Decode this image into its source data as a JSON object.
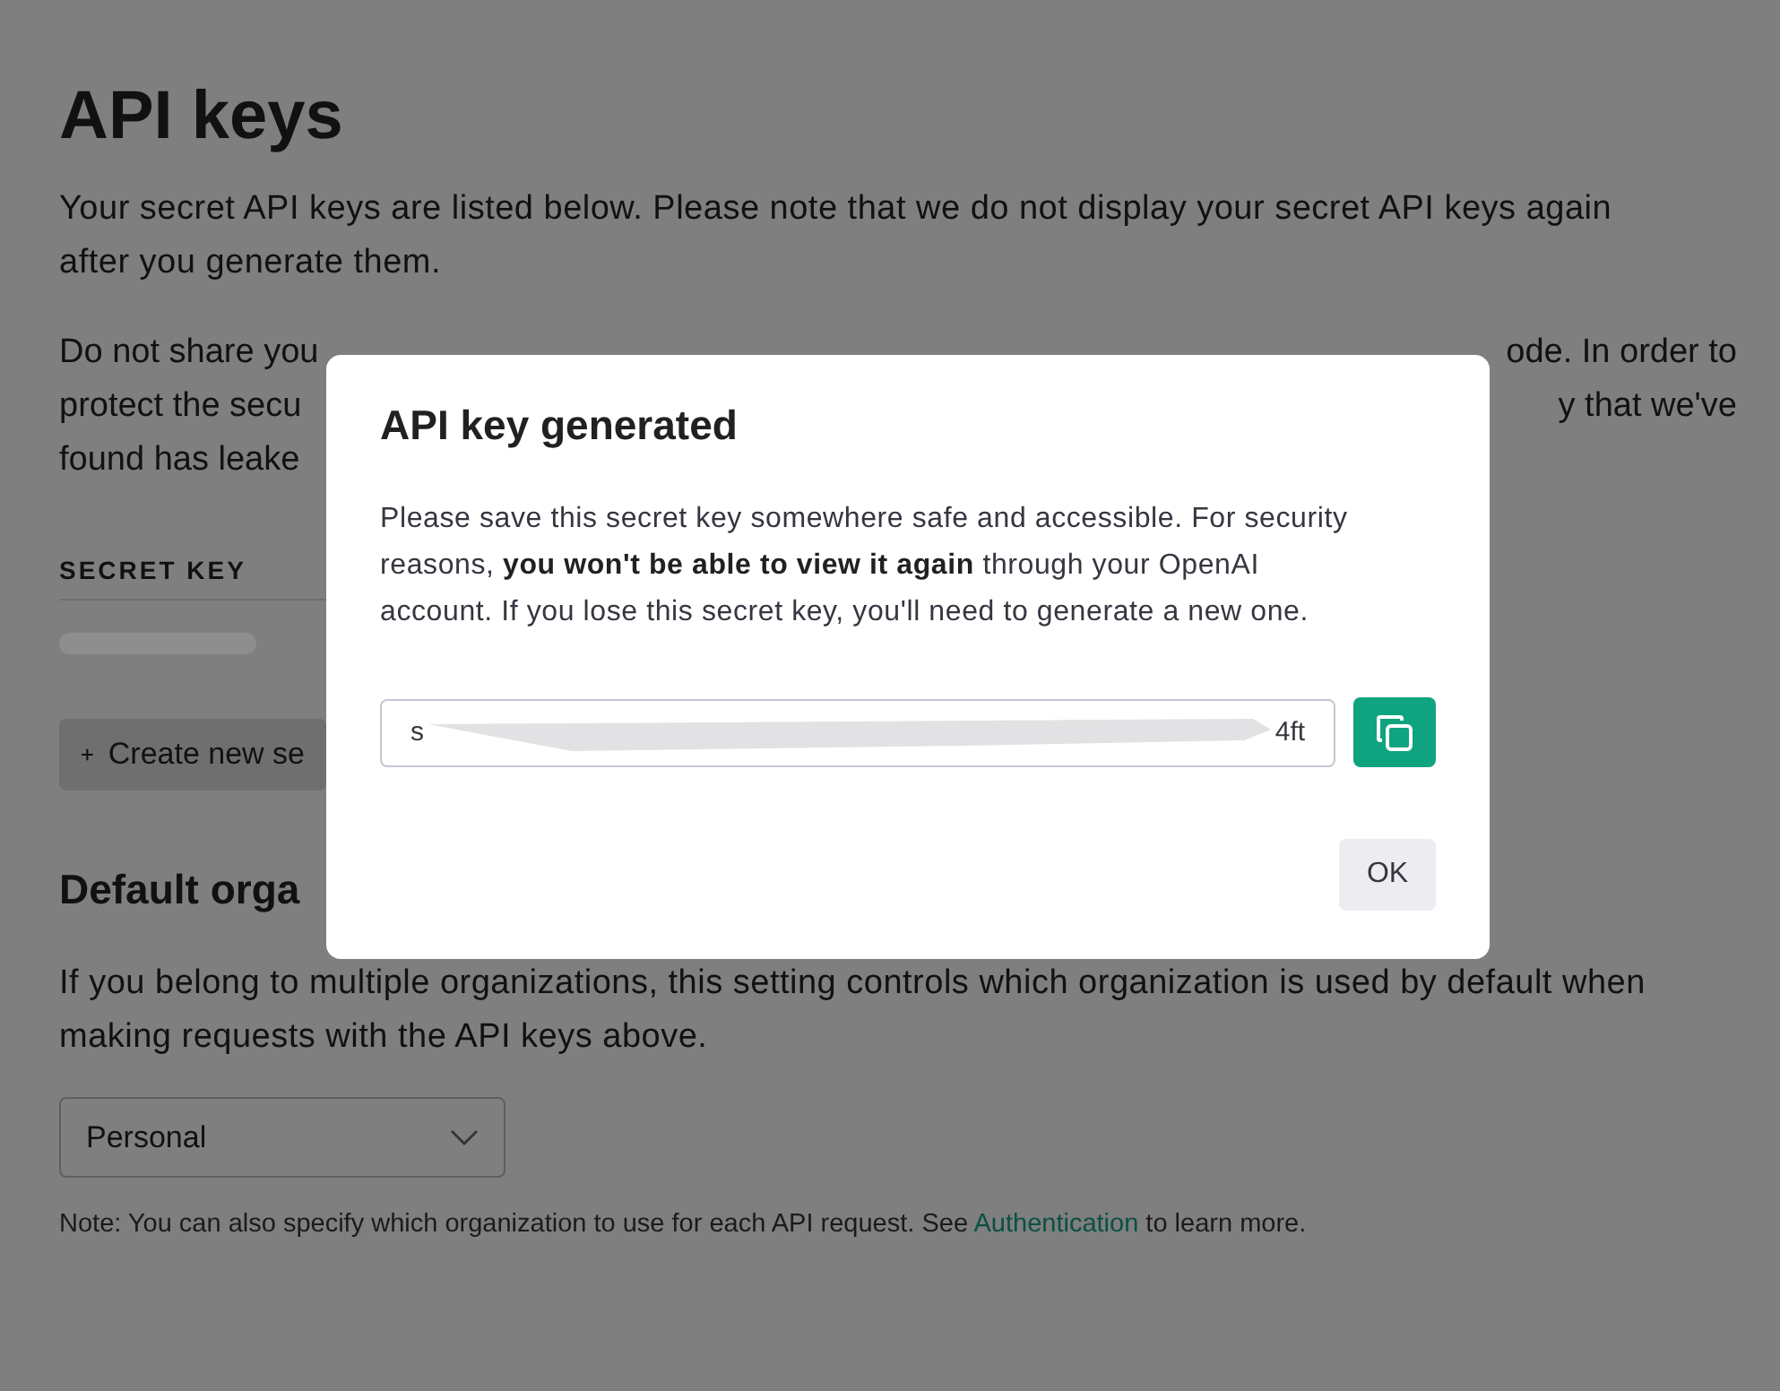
{
  "page": {
    "title": "API keys",
    "intro": "Your secret API keys are listed below. Please note that we do not display your secret API keys again after you generate them.",
    "partial_lines": [
      {
        "left": "Do not share you",
        "right": "ode. In order to"
      },
      {
        "left": "protect the secu",
        "right": "y that we've"
      },
      {
        "left": "found has leake"
      }
    ],
    "keys_table": {
      "column_1": "SECRET KEY"
    },
    "create_button": {
      "label": "Create new se"
    },
    "org_heading": "Default orga",
    "org_text": "If you belong to multiple organizations, this setting controls which organization is used by default when making requests with the API keys above.",
    "org_select": {
      "value": "Personal"
    },
    "note": {
      "before": "Note: You can also specify which organization to use for each API request. See ",
      "link": "Authentication",
      "after": " to learn more."
    }
  },
  "dialog": {
    "title": "API key generated",
    "body": "Please save this secret key somewhere safe and accessible. For security reasons, **you won't be able to view it again** through your OpenAI account. If you lose this secret key, you'll need to generate a new one.",
    "key_field": {
      "start": "s",
      "end": "4ft"
    },
    "ok_button": "OK"
  }
}
